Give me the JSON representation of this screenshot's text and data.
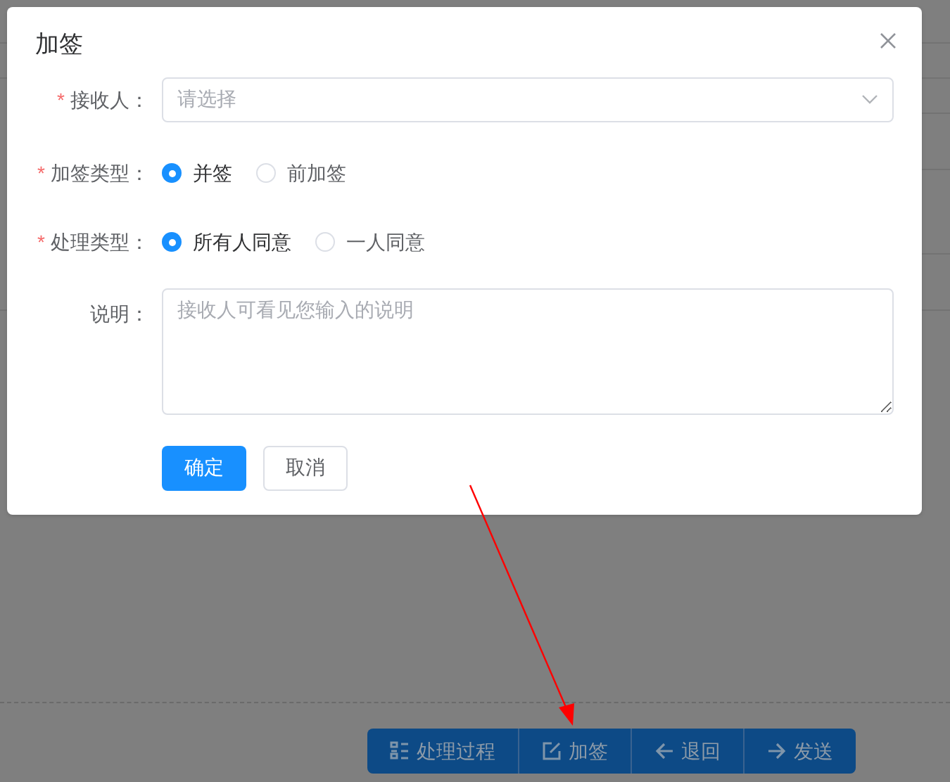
{
  "background": {
    "toolbar": [
      {
        "label": "处理过程"
      },
      {
        "label": "加签"
      },
      {
        "label": "退回"
      },
      {
        "label": "发送"
      }
    ]
  },
  "dialog": {
    "title": "加签",
    "fields": [
      {
        "kind": "select",
        "label": "接收人：",
        "required_mark": "*",
        "placeholder": "请选择"
      },
      {
        "kind": "radio",
        "label": "加签类型：",
        "required_mark": "*",
        "options": [
          {
            "label": "并签",
            "selected": true
          },
          {
            "label": "前加签",
            "selected": false
          }
        ]
      },
      {
        "kind": "radio",
        "label": "处理类型：",
        "required_mark": "*",
        "options": [
          {
            "label": "所有人同意",
            "selected": true
          },
          {
            "label": "一人同意",
            "selected": false
          }
        ]
      },
      {
        "kind": "textarea",
        "label": "说明：",
        "placeholder": "接收人可看见您输入的说明"
      }
    ],
    "buttons": [
      {
        "label": "确定",
        "kind": "primary"
      },
      {
        "label": "取消",
        "kind": "default"
      }
    ]
  }
}
